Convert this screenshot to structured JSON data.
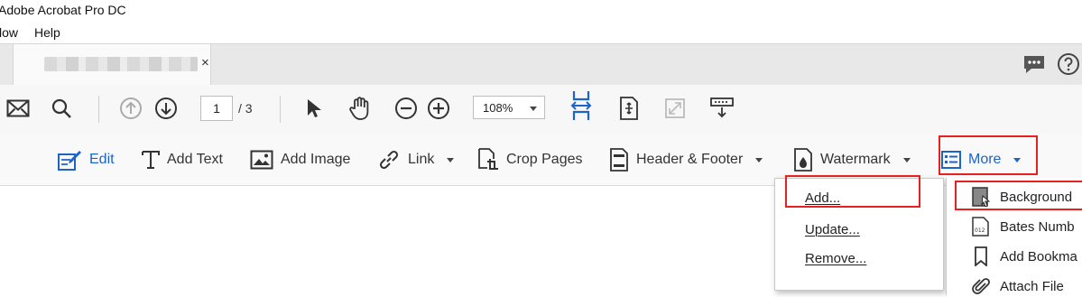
{
  "window": {
    "title": "Adobe Acrobat Pro DC"
  },
  "menubar": {
    "items": [
      "low",
      "Help"
    ]
  },
  "tab": {
    "close_glyph": "×"
  },
  "toolbar": {
    "page_current": "1",
    "page_total": "/ 3",
    "zoom": "108%"
  },
  "edit_toolbar": {
    "edit": "Edit",
    "add_text": "Add Text",
    "add_image": "Add Image",
    "link": "Link",
    "crop_pages": "Crop Pages",
    "header_footer": "Header & Footer",
    "watermark": "Watermark",
    "more": "More"
  },
  "dropdown": {
    "add": "Add...",
    "update": "Update...",
    "remove": "Remove..."
  },
  "submenu": {
    "background": "Background",
    "bates": "Bates Numb",
    "bookmark": "Add Bookma",
    "attach": "Attach File"
  },
  "colors": {
    "accent_blue": "#1e63c7",
    "highlight_red": "#e8201f"
  }
}
